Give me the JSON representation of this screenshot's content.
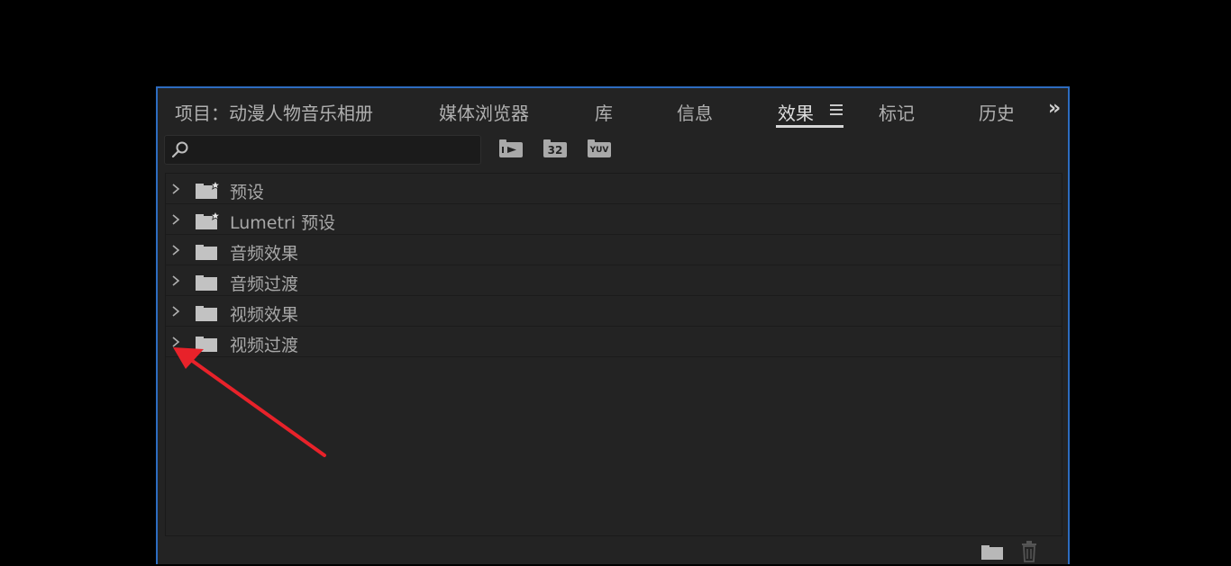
{
  "tabs": [
    {
      "label": "项目：动漫人物音乐相册",
      "active": false
    },
    {
      "label": "媒体浏览器",
      "active": false
    },
    {
      "label": "库",
      "active": false
    },
    {
      "label": "信息",
      "active": false
    },
    {
      "label": "效果",
      "active": true
    },
    {
      "label": "标记",
      "active": false
    },
    {
      "label": "历史",
      "active": false
    }
  ],
  "search": {
    "value": "",
    "placeholder": ""
  },
  "toolbar": {
    "accelerated_icon": "accelerated-effects-icon",
    "bit32_label": "32",
    "yuv_label": "YUV"
  },
  "tree": [
    {
      "label": "预设",
      "icon": "preset-folder-icon"
    },
    {
      "label": "Lumetri 预设",
      "icon": "preset-folder-icon"
    },
    {
      "label": "音频效果",
      "icon": "folder-icon"
    },
    {
      "label": "音频过渡",
      "icon": "folder-icon"
    },
    {
      "label": "视频效果",
      "icon": "folder-icon"
    },
    {
      "label": "视频过渡",
      "icon": "folder-icon"
    }
  ],
  "colors": {
    "panel_bg": "#232323",
    "panel_border": "#2d6cc0",
    "arrow": "#e8222a"
  }
}
